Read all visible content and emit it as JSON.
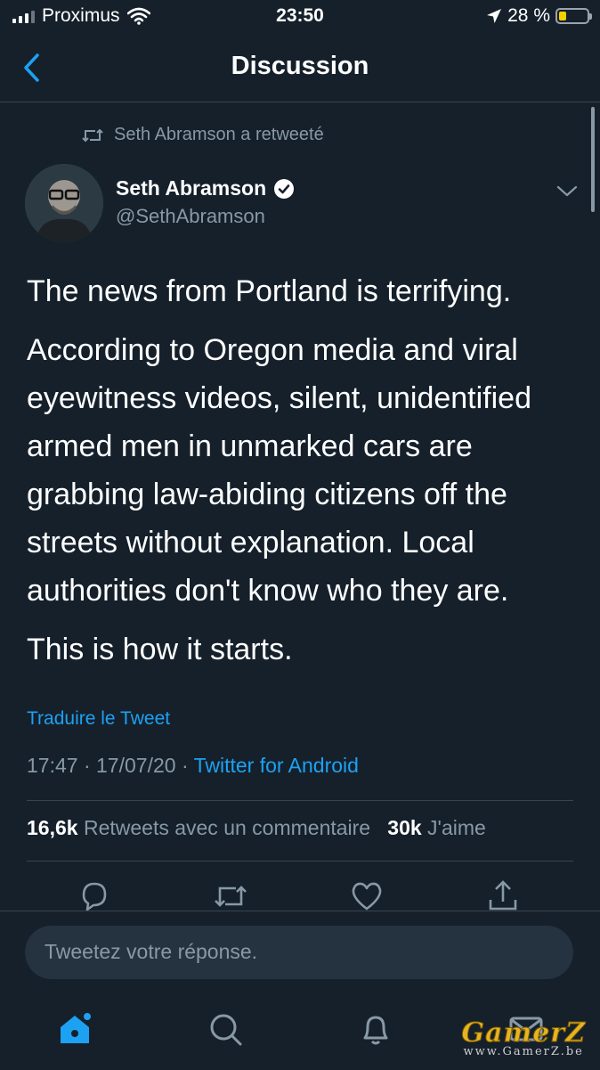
{
  "status_bar": {
    "carrier": "Proximus",
    "time": "23:50",
    "battery_percent": "28 %",
    "battery_level": 0.28,
    "signal_icon": "signal-icon",
    "wifi_icon": "wifi-icon",
    "location_icon": "location-arrow-icon"
  },
  "nav": {
    "title": "Discussion",
    "back_icon": "chevron-left-icon"
  },
  "tweet": {
    "retweet_label": "Seth Abramson a retweeté",
    "author_name": "Seth Abramson",
    "author_handle": "@SethAbramson",
    "verified_icon": "verified-badge-icon",
    "paragraphs": [
      "The news from Portland is terrifying.",
      "According to Oregon media and viral eyewitness videos, silent, unidentified armed men in unmarked cars are grabbing law-abiding citizens off the streets without explanation. Local authorities don't know who they are.",
      "This is how it starts."
    ],
    "translate_label": "Traduire le Tweet",
    "time": "17:47",
    "date": "17/07/20",
    "separator_1": "·",
    "separator_2": "·",
    "source": "Twitter for Android",
    "retweets_count": "16,6k",
    "retweets_label": "Retweets avec un commentaire",
    "likes_count": "30k",
    "likes_label": "J'aime"
  },
  "actions": [
    "reply-icon",
    "retweet-icon",
    "like-icon",
    "share-icon"
  ],
  "reply": {
    "placeholder": "Tweetez votre réponse."
  },
  "tabs": [
    "home-icon",
    "search-icon",
    "notifications-icon",
    "messages-icon"
  ],
  "watermark": {
    "logo": "GamerZ",
    "url": "www.GamerZ.be"
  },
  "colors": {
    "background": "#15202b",
    "accent": "#1da1f2",
    "secondary_text": "#8899a6",
    "divider": "#38444d"
  }
}
